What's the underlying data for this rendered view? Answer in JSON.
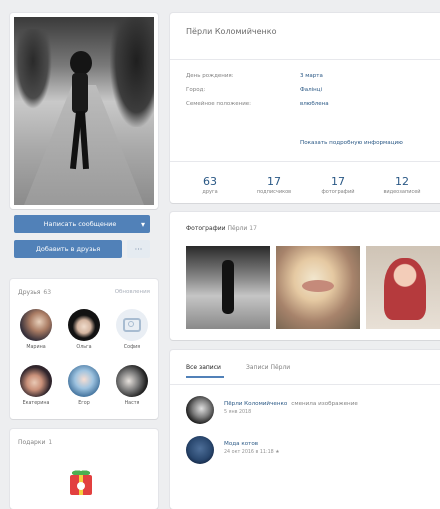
{
  "profile": {
    "name": "Пёрли Коломийченко",
    "info": [
      {
        "label": "День рождения:",
        "value": "3 марта"
      },
      {
        "label": "Город:",
        "value": "Фалінці"
      },
      {
        "label": "Семейное положение:",
        "value": "влюблена"
      }
    ],
    "show_more": "Показать подробную информацию",
    "counters": [
      {
        "num": "63",
        "label": "друга"
      },
      {
        "num": "17",
        "label": "подписчиков"
      },
      {
        "num": "17",
        "label": "фотографий"
      },
      {
        "num": "12",
        "label": "видеозаписей"
      }
    ]
  },
  "actions": {
    "primary": "Написать сообщение",
    "secondary": "Добавить в друзья",
    "more": "···"
  },
  "friends": {
    "title": "Друзья",
    "count": "63",
    "link": "Обновления",
    "items": [
      {
        "name": "Марина"
      },
      {
        "name": "Ольга"
      },
      {
        "name": "София"
      },
      {
        "name": "Екатерина"
      },
      {
        "name": "Егор"
      },
      {
        "name": "Настя"
      }
    ]
  },
  "gifts": {
    "title": "Подарки",
    "count": "1"
  },
  "photos": {
    "title": "Фотографии",
    "owner": "Пёрли",
    "count": "17"
  },
  "wall": {
    "tabs": [
      "Все записи",
      "Записи Пёрли"
    ],
    "posts": [
      {
        "author": "Пёрли Коломийченко",
        "action": "сменила изображение",
        "date": "5 янв 2018"
      },
      {
        "author": "Мода котов",
        "action": "",
        "date": "24 окт 2016 в 11:18 ★"
      }
    ]
  },
  "colors": {
    "accent": "#5181b8",
    "link": "#2a5885",
    "background": "#edeef0"
  }
}
